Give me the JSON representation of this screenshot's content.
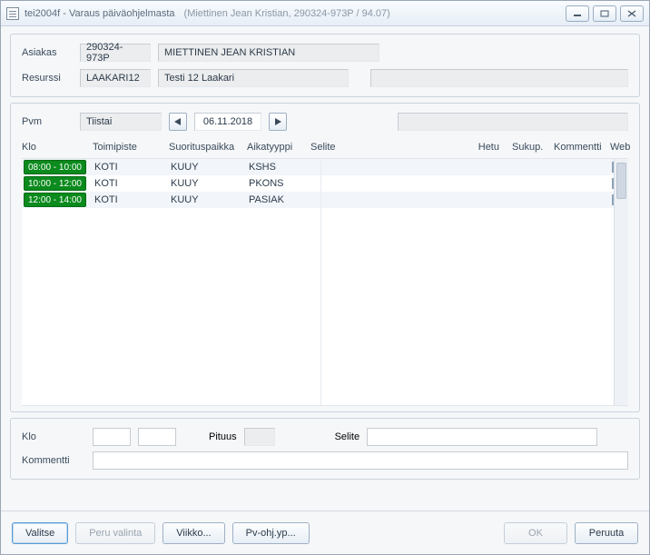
{
  "window": {
    "code": "tei2004f",
    "title": "Varaus päiväohjelmasta",
    "subtitle": "(Miettinen Jean Kristian, 290324-973P / 94.07)"
  },
  "form": {
    "asiakas_label": "Asiakas",
    "asiakas_id": "290324-973P",
    "asiakas_name": "MIETTINEN JEAN KRISTIAN",
    "resurssi_label": "Resurssi",
    "resurssi_code": "LAAKARI12",
    "resurssi_name": "Testi 12 Laakari",
    "pvm_label": "Pvm",
    "weekday": "Tiistai",
    "date": "06.11.2018"
  },
  "grid": {
    "headers": {
      "klo": "Klo",
      "toimipiste": "Toimipiste",
      "suorituspaikka": "Suorituspaikka",
      "aikatyyppi": "Aikatyyppi",
      "selite": "Selite",
      "hetu": "Hetu",
      "sukup": "Sukup.",
      "kommentti": "Kommentti",
      "web": "Web"
    },
    "rows": [
      {
        "klo": "08:00 - 10:00",
        "toimipiste": "KOTI",
        "suorituspaikka": "KUUY",
        "aikatyyppi": "KSHS",
        "selite": "",
        "hetu": "",
        "sukup": "",
        "kommentti": "",
        "web": false
      },
      {
        "klo": "10:00 - 12:00",
        "toimipiste": "KOTI",
        "suorituspaikka": "KUUY",
        "aikatyyppi": "PKONS",
        "selite": "",
        "hetu": "",
        "sukup": "",
        "kommentti": "",
        "web": false
      },
      {
        "klo": "12:00 - 14:00",
        "toimipiste": "KOTI",
        "suorituspaikka": "KUUY",
        "aikatyyppi": "PASIAK",
        "selite": "",
        "hetu": "",
        "sukup": "",
        "kommentti": "",
        "web": false
      }
    ]
  },
  "lower": {
    "klo_label": "Klo",
    "pituus_label": "Pituus",
    "selite_label": "Selite",
    "kommentti_label": "Kommentti",
    "klo_from": "",
    "klo_to": "",
    "pituus": "",
    "selite": "",
    "kommentti": ""
  },
  "footer": {
    "valitse": "Valitse",
    "peru": "Peru valinta",
    "viikko": "Viikko...",
    "pvohj": "Pv-ohj.yp...",
    "ok": "OK",
    "peruuta": "Peruuta"
  }
}
